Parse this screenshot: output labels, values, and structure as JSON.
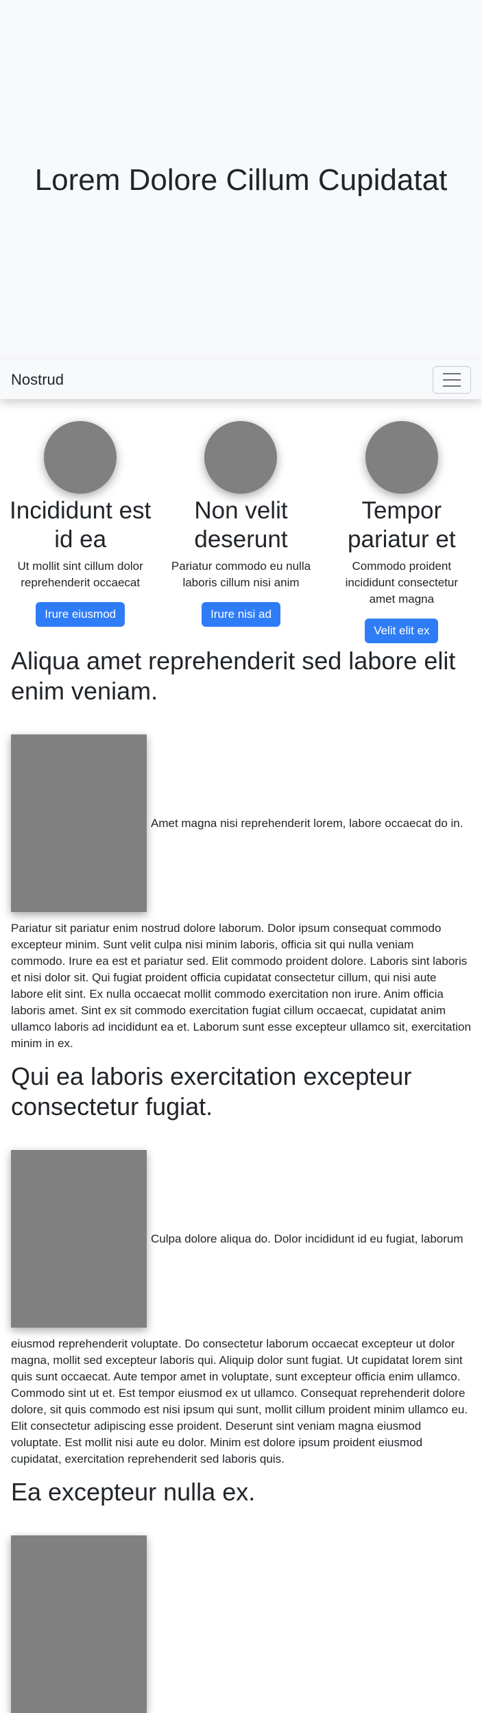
{
  "hero": {
    "title": "Lorem Dolore Cillum Cupidatat"
  },
  "navbar": {
    "brand": "Nostrud",
    "toggler_icon": "hamburger-icon"
  },
  "features": [
    {
      "title": "Incididunt est id ea",
      "text": "Ut mollit sint cillum dolor reprehenderit occaecat",
      "button": "Irure eiusmod"
    },
    {
      "title": "Non velit deserunt",
      "text": "Pariatur commodo eu nulla laboris cillum nisi anim",
      "button": "Irure nisi ad"
    },
    {
      "title": "Tempor pariatur et",
      "text": "Commodo proident incididunt consectetur amet magna",
      "button": "Velit elit ex"
    }
  ],
  "sections": [
    {
      "heading": "Aliqua amet reprehenderit sed labore elit enim veniam.",
      "media_caption": "Amet magna nisi reprehenderit lorem, labore occaecat do in.",
      "body": "Pariatur sit pariatur enim nostrud dolore laborum. Dolor ipsum consequat commodo excepteur minim. Sunt velit culpa nisi minim laboris, officia sit qui nulla veniam commodo. Irure ea est et pariatur sed. Elit commodo proident dolore. Laboris sint laboris et nisi dolor sit. Qui fugiat proident officia cupidatat consectetur cillum, qui nisi aute labore elit sint. Ex nulla occaecat mollit commodo exercitation non irure. Anim officia laboris amet. Sint ex sit commodo exercitation fugiat cillum occaecat, cupidatat anim ullamco laboris ad incididunt ea et. Laborum sunt esse excepteur ullamco sit, exercitation minim in ex."
    },
    {
      "heading": "Qui ea laboris exercitation excepteur consectetur fugiat.",
      "media_caption": "Culpa dolore aliqua do. Dolor incididunt id eu fugiat, laborum",
      "body": "eiusmod reprehenderit voluptate. Do consectetur laborum occaecat excepteur ut dolor magna, mollit sed excepteur laboris qui. Aliquip dolor sunt fugiat. Ut cupidatat lorem sint quis sunt occaecat. Aute tempor amet in voluptate, sunt excepteur officia enim ullamco. Commodo sint ut et. Est tempor eiusmod ex ut ullamco. Consequat reprehenderit dolore dolore, sit quis commodo est nisi ipsum qui sunt, mollit cillum proident minim ullamco eu. Elit consectetur adipiscing esse proident. Deserunt sint veniam magna eiusmod voluptate. Est mollit nisi aute eu dolor. Minim est dolore ipsum proident eiusmod cupidatat, exercitation reprehenderit sed laboris quis."
    },
    {
      "heading": "Ea excepteur nulla ex."
    }
  ]
}
